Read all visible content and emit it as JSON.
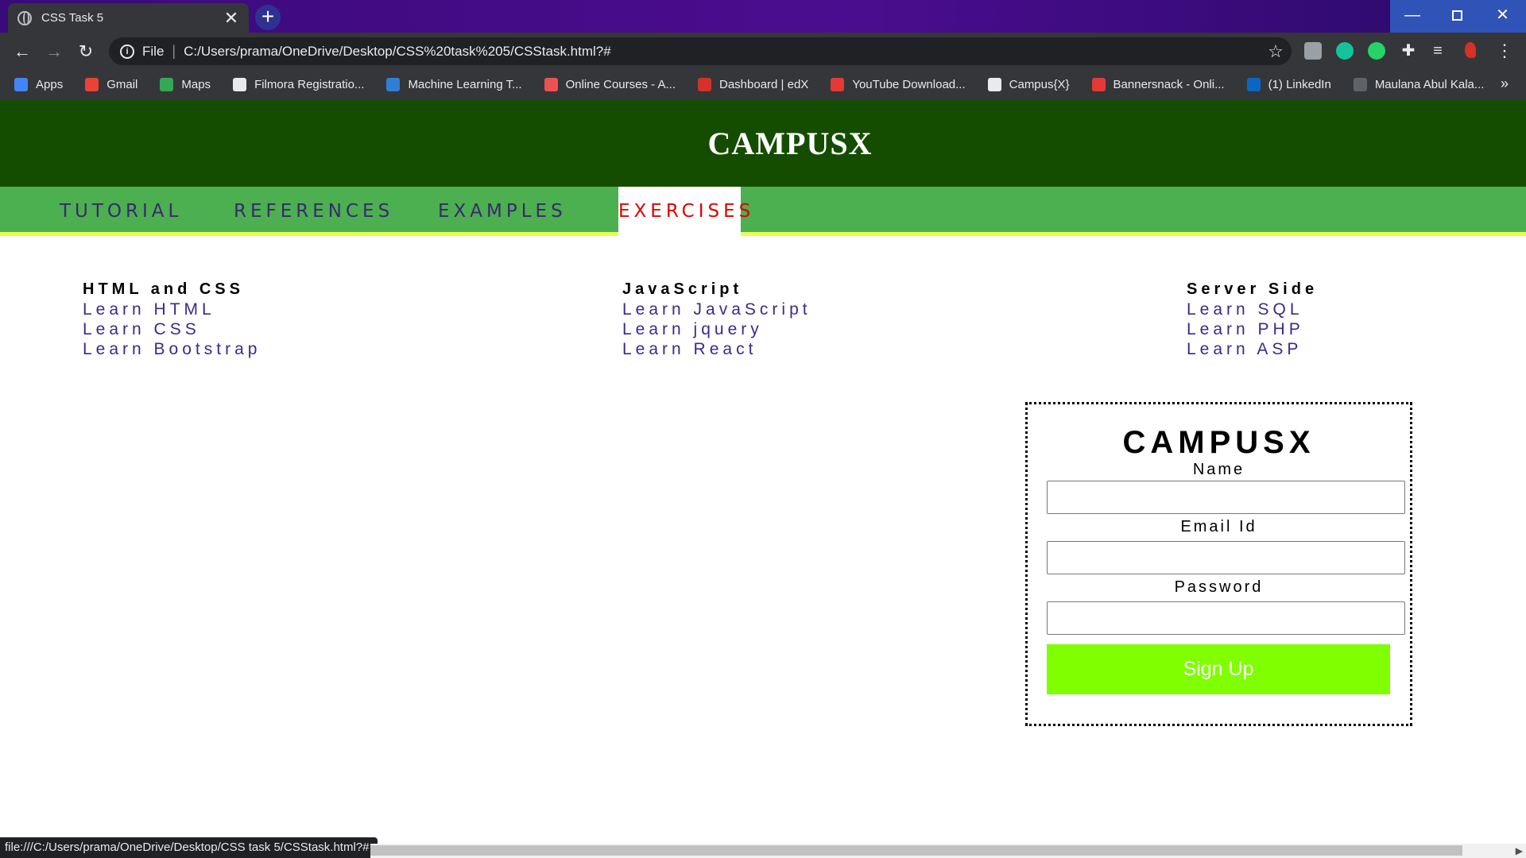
{
  "browser": {
    "tab_title": "CSS Task 5",
    "tab_close": "✕",
    "new_tab": "+",
    "window": {
      "minimize": "—",
      "close": "✕"
    },
    "nav": {
      "back": "←",
      "forward": "→",
      "reload": "↻"
    },
    "address": {
      "scheme": "File",
      "separator": "|",
      "url": "C:/Users/prama/OneDrive/Desktop/CSS%20task%205/CSStask.html?#",
      "star": "☆"
    },
    "extensions": {
      "puzzle": "✚",
      "media": "≡",
      "menu": "⋮"
    },
    "bookmarks": [
      {
        "label": "Apps",
        "icon": "apps-grid-icon",
        "color": "#4285f4"
      },
      {
        "label": "Gmail",
        "icon": "gmail-icon",
        "color": "#ea4335"
      },
      {
        "label": "Maps",
        "icon": "maps-pin-icon",
        "color": "#34a853"
      },
      {
        "label": "Filmora Registratio...",
        "icon": "globe-icon",
        "color": "#e8eaed"
      },
      {
        "label": "Machine Learning T...",
        "icon": "s-logo-icon",
        "color": "#2f7fd8"
      },
      {
        "label": "Online Courses - A...",
        "icon": "udemy-icon",
        "color": "#ec5252"
      },
      {
        "label": "Dashboard | edX",
        "icon": "edx-icon",
        "color": "#d23228"
      },
      {
        "label": "YouTube Download...",
        "icon": "download-icon",
        "color": "#e53935"
      },
      {
        "label": "Campus{X}",
        "icon": "globe-icon",
        "color": "#e8eaed"
      },
      {
        "label": "Bannersnack - Onli...",
        "icon": "bannersnack-icon",
        "color": "#e53935"
      },
      {
        "label": "(1) LinkedIn",
        "icon": "linkedin-icon",
        "color": "#0a66c2"
      },
      {
        "label": "Maulana Abul Kala...",
        "icon": "cap-icon",
        "color": "#5f6368"
      }
    ],
    "bookmarks_more": "»",
    "status_url": "file:///C:/Users/prama/OneDrive/Desktop/CSS task 5/CSStask.html?#"
  },
  "page": {
    "header_title": "CAMPUSX",
    "nav_items": [
      "TUTORIAL",
      "REFERENCES",
      "EXAMPLES",
      "EXERCISES"
    ],
    "active_nav": "EXERCISES",
    "columns": [
      {
        "heading": "HTML and CSS",
        "links": [
          "Learn HTML",
          "Learn CSS",
          "Learn Bootstrap"
        ]
      },
      {
        "heading": "JavaScript",
        "links": [
          "Learn JavaScript",
          "Learn jquery",
          "Learn React"
        ]
      },
      {
        "heading": "Server Side",
        "links": [
          "Learn SQL",
          "Learn PHP",
          "Learn ASP"
        ]
      }
    ],
    "form": {
      "brand": "CAMPUSX",
      "name_label": "Name",
      "email_label": "Email Id",
      "password_label": "Password",
      "name_value": "",
      "email_value": "",
      "password_value": "",
      "submit_label": "Sign Up"
    },
    "colors": {
      "header_bg": "#144d00",
      "nav_bg": "#4caf50",
      "nav_underline": "#e6ff4d",
      "active_nav_text": "#e00000",
      "link_text": "#3a2a8b",
      "button_bg": "#7fff00"
    }
  }
}
